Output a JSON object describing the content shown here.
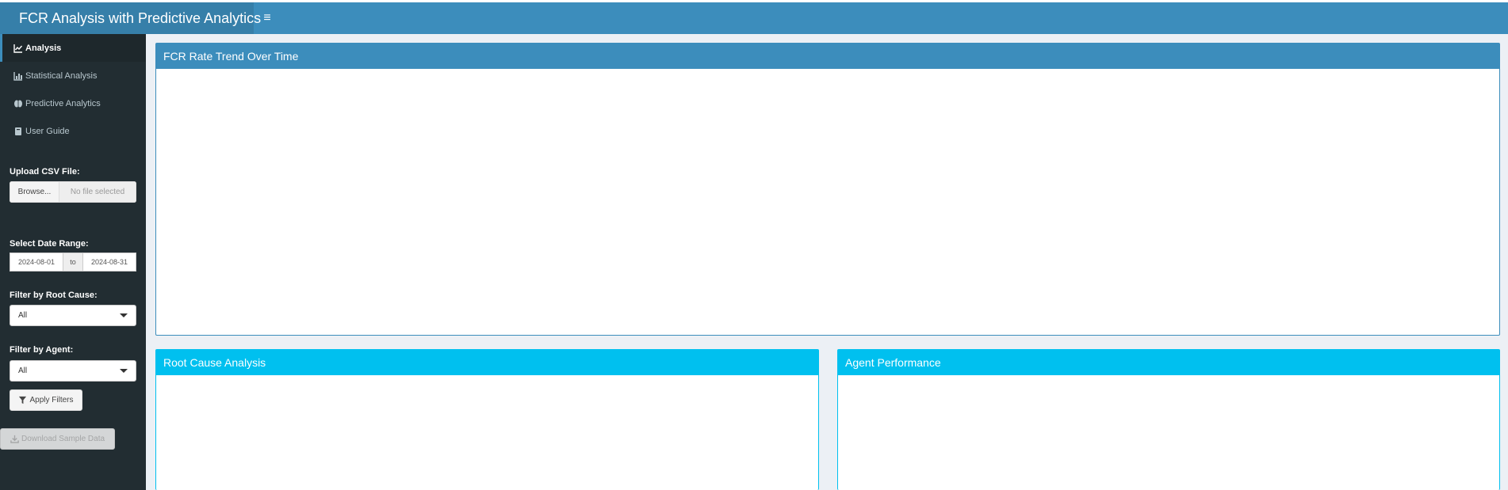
{
  "header": {
    "title": "FCR Analysis with Predictive Analytics",
    "toggle_icon": "≡"
  },
  "sidebar": {
    "menu": [
      {
        "label": "Analysis",
        "icon": "line-chart-icon",
        "active": true
      },
      {
        "label": "Statistical Analysis",
        "icon": "bar-chart-icon",
        "active": false
      },
      {
        "label": "Predictive Analytics",
        "icon": "brain-icon",
        "active": false
      },
      {
        "label": "User Guide",
        "icon": "book-icon",
        "active": false
      }
    ],
    "upload": {
      "label": "Upload CSV File:",
      "browse_label": "Browse...",
      "file_placeholder": "No file selected"
    },
    "date_range": {
      "label": "Select Date Range:",
      "start": "2024-08-01",
      "separator": "to",
      "end": "2024-08-31"
    },
    "root_cause": {
      "label": "Filter by Root Cause:",
      "value": "All"
    },
    "agent": {
      "label": "Filter by Agent:",
      "value": "All"
    },
    "apply_label": "Apply Filters",
    "download_label": "Download Sample Data"
  },
  "main": {
    "trend_title": "FCR Rate Trend Over Time",
    "root_cause_title": "Root Cause Analysis",
    "agent_title": "Agent Performance"
  },
  "colors": {
    "header": "#3c8dbc",
    "logo": "#367fa9",
    "sidebar": "#222d32",
    "primary_box": "#3c8dbc",
    "info_box": "#00c0ef"
  }
}
